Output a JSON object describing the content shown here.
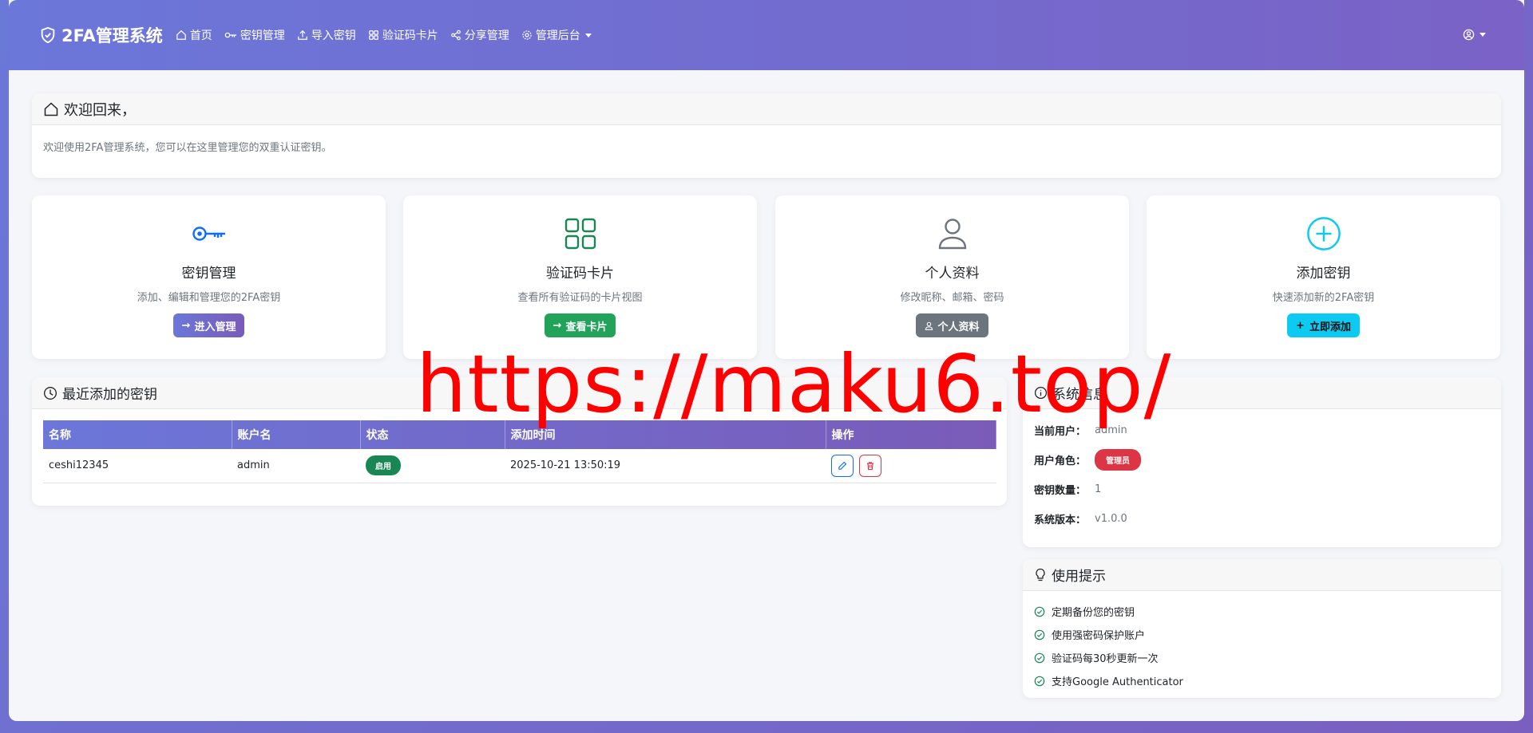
{
  "navbar": {
    "brand": "2FA管理系统",
    "items": [
      {
        "label": "首页",
        "icon": "home-icon"
      },
      {
        "label": "密钥管理",
        "icon": "key-icon"
      },
      {
        "label": "导入密钥",
        "icon": "upload-icon"
      },
      {
        "label": "验证码卡片",
        "icon": "grid-icon"
      },
      {
        "label": "分享管理",
        "icon": "share-icon"
      },
      {
        "label": "管理后台",
        "icon": "gear-icon",
        "dropdown": true
      }
    ],
    "user_icon": "user-circle-icon"
  },
  "welcome": {
    "title": "欢迎回来，",
    "text": "欢迎使用2FA管理系统，您可以在这里管理您的双重认证密钥。"
  },
  "features": [
    {
      "title": "密钥管理",
      "desc": "添加、编辑和管理您的2FA密钥",
      "button": "进入管理",
      "icon": "key-icon",
      "color": "#0d6efd",
      "btn_color": "#6f6fd2"
    },
    {
      "title": "验证码卡片",
      "desc": "查看所有验证码的卡片视图",
      "button": "查看卡片",
      "icon": "grid-icon",
      "color": "#198754",
      "btn_color": "#22a35a"
    },
    {
      "title": "个人资料",
      "desc": "修改昵称、邮箱、密码",
      "button": "个人资料",
      "icon": "person-icon",
      "color": "#6c757d",
      "btn_color": "#6c757d"
    },
    {
      "title": "添加密钥",
      "desc": "快速添加新的2FA密钥",
      "button": "立即添加",
      "icon": "plus-circle-icon",
      "color": "#0dcaf0",
      "btn_color": "#0dcaf0"
    }
  ],
  "recent": {
    "title": "最近添加的密钥",
    "columns": [
      "名称",
      "账户名",
      "状态",
      "添加时间",
      "操作"
    ],
    "rows": [
      {
        "name": "ceshi12345",
        "account": "admin",
        "status": "启用",
        "time": "2025-10-21 13:50:19"
      }
    ]
  },
  "sysinfo": {
    "title": "系统信息",
    "user_label": "当前用户：",
    "user_value": "admin",
    "role_label": "用户角色：",
    "role_value": "管理员",
    "count_label": "密钥数量：",
    "count_value": "1",
    "version_label": "系统版本：",
    "version_value": "v1.0.0"
  },
  "tips": {
    "title": "使用提示",
    "items": [
      "定期备份您的密钥",
      "使用强密码保护账户",
      "验证码每30秒更新一次",
      "支持Google Authenticator"
    ]
  },
  "watermark": "https://maku6.top/"
}
